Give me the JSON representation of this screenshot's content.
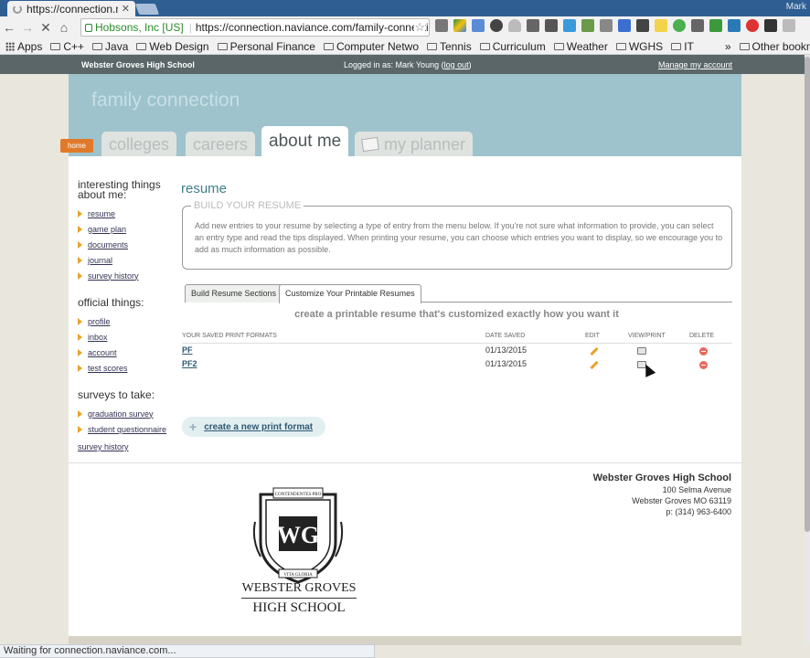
{
  "browser": {
    "tab_title": "https://connection.n",
    "user": "Mark",
    "ev_name": "Hobsons, Inc [US]",
    "url": "https://connection.naviance.com/family-connection",
    "status": "Waiting for connection.naviance.com...",
    "bookmarks": [
      "Apps",
      "C++",
      "Java",
      "Web Design",
      "Personal Finance",
      "Computer Netwo",
      "Tennis",
      "Curriculum",
      "Weather",
      "WGHS",
      "IT",
      "»",
      "Other bookmarks"
    ]
  },
  "topbar": {
    "school": "Webster Groves High School",
    "logged_in": "Logged in as: Mark Young (",
    "logout": "log out",
    "logged_in_end": ")",
    "manage": "Manage my account"
  },
  "header": {
    "title": "family connection",
    "home": "home",
    "tabs": [
      "colleges",
      "careers",
      "about me",
      "my planner"
    ],
    "active_tab": "about me"
  },
  "sidebar": {
    "interesting_heading": "interesting things about me:",
    "interesting": [
      "resume",
      "game plan",
      "documents",
      "journal",
      "survey history"
    ],
    "official_heading": "official things:",
    "official": [
      "profile",
      "inbox",
      "account",
      "test scores"
    ],
    "surveys_heading": "surveys to take:",
    "surveys": [
      "graduation survey",
      "student questionnaire"
    ],
    "survey_history": "survey history"
  },
  "main": {
    "title": "resume",
    "build_legend": "BUILD YOUR RESUME",
    "build_text": "Add new entries to your resume by selecting a type of entry from the menu below. If you're not sure what information to provide, you can select an entry type and read the tips displayed. When printing your resume, you can choose which entries you want to display, so we encourage you to add as much information as possible.",
    "subtabs": [
      "Build Resume Sections",
      "Customize Your Printable Resumes"
    ],
    "active_subtab": "Customize Your Printable Resumes",
    "heading": "create a printable resume that's customized exactly how you want it",
    "columns": [
      "YOUR SAVED PRINT FORMATS",
      "DATE SAVED",
      "EDIT",
      "VIEW/PRINT",
      "DELETE"
    ],
    "rows": [
      {
        "name": "PF",
        "date": "01/13/2015"
      },
      {
        "name": "PF2",
        "date": "01/13/2015"
      }
    ],
    "create_label": "create a new print format"
  },
  "footer": {
    "name": "Webster Groves High School",
    "street": "100 Selma Avenue",
    "city": "Webster Groves MO 63119",
    "phone": "p: (314) 963-6400",
    "logo_line1": "WEBSTER GROVES",
    "logo_line2": "HIGH SCHOOL",
    "crest_motto_top": "CONTENDENTES PRO",
    "crest_motto_bottom": "VITA GLORIA"
  },
  "colors": {
    "header_bg": "#9ec3cd",
    "topbar_bg": "#5b6669",
    "home_tab": "#e07a2a",
    "accent_title": "#3f7f8a"
  }
}
